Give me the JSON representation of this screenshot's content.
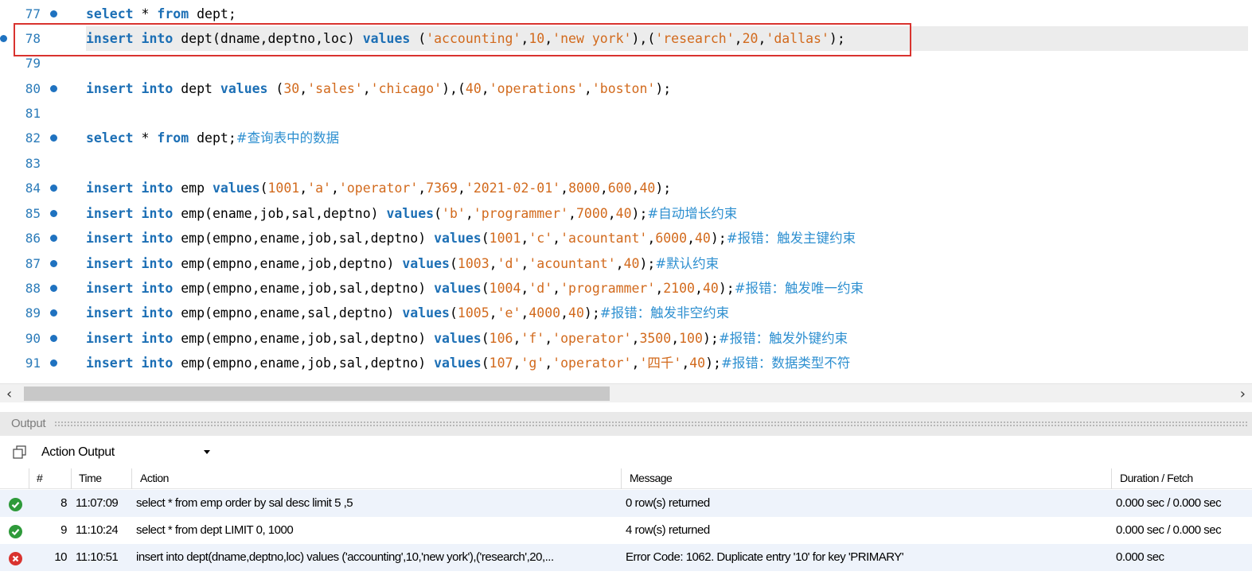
{
  "editor": {
    "lines": [
      {
        "num": "77",
        "bullet": true,
        "tokens": [
          [
            "kw",
            "select"
          ],
          [
            "plain",
            " * "
          ],
          [
            "kw",
            "from"
          ],
          [
            "plain",
            " dept;"
          ]
        ]
      },
      {
        "num": "78",
        "bullet": true,
        "current": true,
        "tokens": [
          [
            "kw",
            "insert into"
          ],
          [
            "plain",
            " dept(dname,deptno,loc) "
          ],
          [
            "kw",
            "values"
          ],
          [
            "plain",
            " ("
          ],
          [
            "str",
            "'accounting'"
          ],
          [
            "plain",
            ","
          ],
          [
            "num",
            "10"
          ],
          [
            "plain",
            ","
          ],
          [
            "str",
            "'new york'"
          ],
          [
            "plain",
            "),("
          ],
          [
            "str",
            "'research'"
          ],
          [
            "plain",
            ","
          ],
          [
            "num",
            "20"
          ],
          [
            "plain",
            ","
          ],
          [
            "str",
            "'dallas'"
          ],
          [
            "plain",
            ");"
          ]
        ]
      },
      {
        "num": "79",
        "bullet": false,
        "tokens": []
      },
      {
        "num": "80",
        "bullet": true,
        "tokens": [
          [
            "kw",
            "insert into"
          ],
          [
            "plain",
            " dept "
          ],
          [
            "kw",
            "values"
          ],
          [
            "plain",
            " ("
          ],
          [
            "num",
            "30"
          ],
          [
            "plain",
            ","
          ],
          [
            "str",
            "'sales'"
          ],
          [
            "plain",
            ","
          ],
          [
            "str",
            "'chicago'"
          ],
          [
            "plain",
            "),("
          ],
          [
            "num",
            "40"
          ],
          [
            "plain",
            ","
          ],
          [
            "str",
            "'operations'"
          ],
          [
            "plain",
            ","
          ],
          [
            "str",
            "'boston'"
          ],
          [
            "plain",
            ");"
          ]
        ]
      },
      {
        "num": "81",
        "bullet": false,
        "tokens": []
      },
      {
        "num": "82",
        "bullet": true,
        "tokens": [
          [
            "kw",
            "select"
          ],
          [
            "plain",
            " * "
          ],
          [
            "kw",
            "from"
          ],
          [
            "plain",
            " dept;"
          ],
          [
            "cmt",
            "#查询表中的数据"
          ]
        ]
      },
      {
        "num": "83",
        "bullet": false,
        "tokens": []
      },
      {
        "num": "84",
        "bullet": true,
        "tokens": [
          [
            "kw",
            "insert into"
          ],
          [
            "plain",
            " emp "
          ],
          [
            "kw",
            "values"
          ],
          [
            "plain",
            "("
          ],
          [
            "num",
            "1001"
          ],
          [
            "plain",
            ","
          ],
          [
            "str",
            "'a'"
          ],
          [
            "plain",
            ","
          ],
          [
            "str",
            "'operator'"
          ],
          [
            "plain",
            ","
          ],
          [
            "num",
            "7369"
          ],
          [
            "plain",
            ","
          ],
          [
            "str",
            "'2021-02-01'"
          ],
          [
            "plain",
            ","
          ],
          [
            "num",
            "8000"
          ],
          [
            "plain",
            ","
          ],
          [
            "num",
            "600"
          ],
          [
            "plain",
            ","
          ],
          [
            "num",
            "40"
          ],
          [
            "plain",
            ");"
          ]
        ]
      },
      {
        "num": "85",
        "bullet": true,
        "tokens": [
          [
            "kw",
            "insert into"
          ],
          [
            "plain",
            " emp(ename,job,sal,deptno) "
          ],
          [
            "kw",
            "values"
          ],
          [
            "plain",
            "("
          ],
          [
            "str",
            "'b'"
          ],
          [
            "plain",
            ","
          ],
          [
            "str",
            "'programmer'"
          ],
          [
            "plain",
            ","
          ],
          [
            "num",
            "7000"
          ],
          [
            "plain",
            ","
          ],
          [
            "num",
            "40"
          ],
          [
            "plain",
            ");"
          ],
          [
            "cmt",
            "#自动增长约束"
          ]
        ]
      },
      {
        "num": "86",
        "bullet": true,
        "tokens": [
          [
            "kw",
            "insert into"
          ],
          [
            "plain",
            " emp(empno,ename,job,sal,deptno) "
          ],
          [
            "kw",
            "values"
          ],
          [
            "plain",
            "("
          ],
          [
            "num",
            "1001"
          ],
          [
            "plain",
            ","
          ],
          [
            "str",
            "'c'"
          ],
          [
            "plain",
            ","
          ],
          [
            "str",
            "'acountant'"
          ],
          [
            "plain",
            ","
          ],
          [
            "num",
            "6000"
          ],
          [
            "plain",
            ","
          ],
          [
            "num",
            "40"
          ],
          [
            "plain",
            ");"
          ],
          [
            "cmt",
            "#报错：触发主键约束"
          ]
        ]
      },
      {
        "num": "87",
        "bullet": true,
        "tokens": [
          [
            "kw",
            "insert into"
          ],
          [
            "plain",
            " emp(empno,ename,job,deptno) "
          ],
          [
            "kw",
            "values"
          ],
          [
            "plain",
            "("
          ],
          [
            "num",
            "1003"
          ],
          [
            "plain",
            ","
          ],
          [
            "str",
            "'d'"
          ],
          [
            "plain",
            ","
          ],
          [
            "str",
            "'acountant'"
          ],
          [
            "plain",
            ","
          ],
          [
            "num",
            "40"
          ],
          [
            "plain",
            ");"
          ],
          [
            "cmt",
            "#默认约束"
          ]
        ]
      },
      {
        "num": "88",
        "bullet": true,
        "tokens": [
          [
            "kw",
            "insert into"
          ],
          [
            "plain",
            " emp(empno,ename,job,sal,deptno) "
          ],
          [
            "kw",
            "values"
          ],
          [
            "plain",
            "("
          ],
          [
            "num",
            "1004"
          ],
          [
            "plain",
            ","
          ],
          [
            "str",
            "'d'"
          ],
          [
            "plain",
            ","
          ],
          [
            "str",
            "'programmer'"
          ],
          [
            "plain",
            ","
          ],
          [
            "num",
            "2100"
          ],
          [
            "plain",
            ","
          ],
          [
            "num",
            "40"
          ],
          [
            "plain",
            ");"
          ],
          [
            "cmt",
            "#报错：触发唯一约束"
          ]
        ]
      },
      {
        "num": "89",
        "bullet": true,
        "tokens": [
          [
            "kw",
            "insert into"
          ],
          [
            "plain",
            " emp(empno,ename,sal,deptno) "
          ],
          [
            "kw",
            "values"
          ],
          [
            "plain",
            "("
          ],
          [
            "num",
            "1005"
          ],
          [
            "plain",
            ","
          ],
          [
            "str",
            "'e'"
          ],
          [
            "plain",
            ","
          ],
          [
            "num",
            "4000"
          ],
          [
            "plain",
            ","
          ],
          [
            "num",
            "40"
          ],
          [
            "plain",
            ");"
          ],
          [
            "cmt",
            "#报错：触发非空约束"
          ]
        ]
      },
      {
        "num": "90",
        "bullet": true,
        "tokens": [
          [
            "kw",
            "insert into"
          ],
          [
            "plain",
            " emp(empno,ename,job,sal,deptno) "
          ],
          [
            "kw",
            "values"
          ],
          [
            "plain",
            "("
          ],
          [
            "num",
            "106"
          ],
          [
            "plain",
            ","
          ],
          [
            "str",
            "'f'"
          ],
          [
            "plain",
            ","
          ],
          [
            "str",
            "'operator'"
          ],
          [
            "plain",
            ","
          ],
          [
            "num",
            "3500"
          ],
          [
            "plain",
            ","
          ],
          [
            "num",
            "100"
          ],
          [
            "plain",
            ");"
          ],
          [
            "cmt",
            "#报错：触发外键约束"
          ]
        ]
      },
      {
        "num": "91",
        "bullet": true,
        "tokens": [
          [
            "kw",
            "insert into"
          ],
          [
            "plain",
            " emp(empno,ename,job,sal,deptno) "
          ],
          [
            "kw",
            "values"
          ],
          [
            "plain",
            "("
          ],
          [
            "num",
            "107"
          ],
          [
            "plain",
            ","
          ],
          [
            "str",
            "'g'"
          ],
          [
            "plain",
            ","
          ],
          [
            "str",
            "'operator'"
          ],
          [
            "plain",
            ","
          ],
          [
            "str",
            "'四千'"
          ],
          [
            "plain",
            ","
          ],
          [
            "num",
            "40"
          ],
          [
            "plain",
            ");"
          ],
          [
            "cmt",
            "#报错：数据类型不符"
          ]
        ]
      }
    ]
  },
  "output": {
    "title": "Output",
    "selector_value": "Action Output",
    "columns": [
      "#",
      "Time",
      "Action",
      "Message",
      "Duration / Fetch"
    ],
    "rows": [
      {
        "status": "ok",
        "num": "8",
        "time": "11:07:09",
        "action": "select * from emp order by sal desc limit 5 ,5",
        "message": "0 row(s) returned",
        "duration": "0.000 sec / 0.000 sec"
      },
      {
        "status": "ok",
        "num": "9",
        "time": "11:10:24",
        "action": "select * from dept LIMIT 0, 1000",
        "message": "4 row(s) returned",
        "duration": "0.000 sec / 0.000 sec"
      },
      {
        "status": "error",
        "num": "10",
        "time": "11:10:51",
        "action": "insert into dept(dname,deptno,loc) values ('accounting',10,'new york'),('research',20,...",
        "message": "Error Code: 1062. Duplicate entry '10' for key 'PRIMARY'",
        "duration": "0.000 sec"
      }
    ]
  },
  "colors": {
    "keyword": "#1c6fb5",
    "string": "#d26a1d",
    "comment": "#2d8fd0",
    "line_number": "#2b7bb9",
    "highlight_box": "#d9332f",
    "ok": "#2e9a3a",
    "error": "#d9332f"
  },
  "icons": {
    "breakpoint": "bullet-dot-icon",
    "copy": "copy-icon",
    "ok": "check-circle-icon",
    "error": "x-circle-icon",
    "dropdown": "caret-down-icon",
    "scroll_left": "chevron-left-icon",
    "scroll_right": "chevron-right-icon"
  }
}
